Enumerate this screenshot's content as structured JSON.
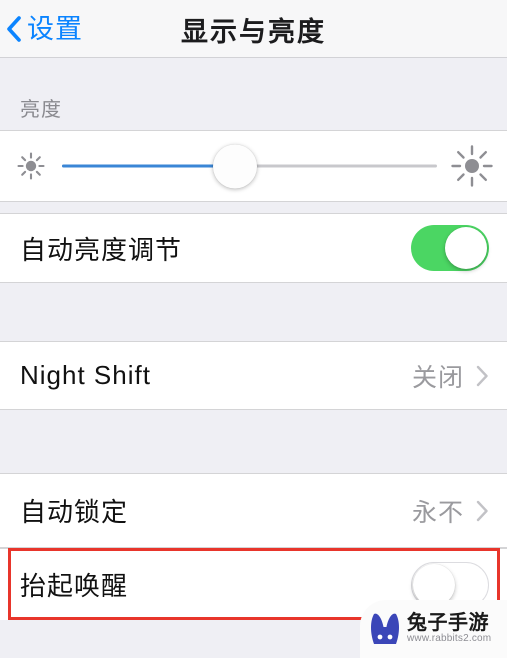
{
  "navbar": {
    "back_label": "设置",
    "back_icon": "chevron-left-icon",
    "title": "显示与亮度"
  },
  "sections": {
    "brightness": {
      "header": "亮度",
      "slider": {
        "name": "brightness-slider",
        "value_percent": 46,
        "min_icon": "sun-small-icon",
        "max_icon": "sun-large-icon"
      },
      "auto_brightness": {
        "label": "自动亮度调节",
        "toggle_state": "on",
        "toggle_color": "#4bd663"
      }
    },
    "night_shift": {
      "label": "Night Shift",
      "value": "关闭",
      "accessory_icon": "chevron-right-icon"
    },
    "lock": {
      "auto_lock": {
        "label": "自动锁定",
        "value": "永不",
        "accessory_icon": "chevron-right-icon"
      },
      "raise_to_wake": {
        "label": "抬起唤醒",
        "toggle_state": "off",
        "highlighted": true,
        "highlight_color": "#e8352b"
      }
    }
  },
  "watermark": {
    "logo_icon": "rabbit-logo-icon",
    "title": "兔子手游",
    "url": "www.rabbits2.com"
  },
  "colors": {
    "accent_blue": "#0b84ff",
    "slider_blue": "#3a86d6",
    "toggle_green": "#4bd663",
    "highlight_red": "#e8352b",
    "background_gray": "#efeff4"
  }
}
